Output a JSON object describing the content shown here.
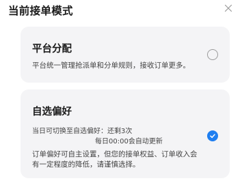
{
  "dialog": {
    "title": "当前接单模式"
  },
  "options": [
    {
      "name": "平台分配",
      "description": "平台统一管理抢派单和分单规则，接收订单更多。",
      "selected": false
    },
    {
      "name": "自选偏好",
      "switch_info_line1": "当日可切换至自选偏好：还剩3次",
      "switch_info_line2": "每日00:00会自动更新",
      "warning_line1": "订单偏好可自主设置，但您的接单权益、订单收入会",
      "warning_line2": "有一定程度的降低，请谨慎选择。",
      "selected": true
    }
  ],
  "colors": {
    "accent": "#1e7ef0",
    "card_bg": "#f4f4f6"
  },
  "icons": {
    "close": "close-icon",
    "selected": "check-icon"
  }
}
